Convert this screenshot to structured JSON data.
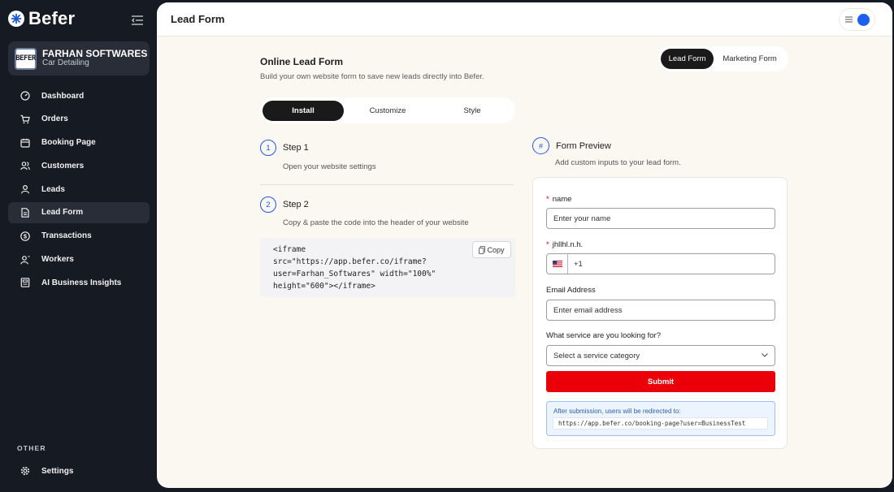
{
  "brand": {
    "name": "Befer"
  },
  "company": {
    "avatar_text": "BEFER",
    "name": "FARHAN SOFTWARES",
    "subtitle": "Car Detailing"
  },
  "sidebar": {
    "items": [
      {
        "label": "Dashboard",
        "icon": "gauge-icon"
      },
      {
        "label": "Orders",
        "icon": "cart-icon"
      },
      {
        "label": "Booking Page",
        "icon": "calendar-icon"
      },
      {
        "label": "Customers",
        "icon": "users-icon"
      },
      {
        "label": "Leads",
        "icon": "user-icon"
      },
      {
        "label": "Lead Form",
        "icon": "document-icon",
        "active": true
      },
      {
        "label": "Transactions",
        "icon": "dollar-icon"
      },
      {
        "label": "Workers",
        "icon": "workers-icon"
      },
      {
        "label": "AI Business Insights",
        "icon": "report-icon"
      }
    ],
    "section_other": "OTHER",
    "settings_label": "Settings"
  },
  "header": {
    "title": "Lead Form"
  },
  "page": {
    "title": "Online Lead Form",
    "subtitle": "Build your own website form to save new leads directly into Befer.",
    "toggle": {
      "active": "Lead Form",
      "inactive": "Marketing Form"
    },
    "tabs": [
      "Install",
      "Customize",
      "Style"
    ],
    "step1": {
      "num": "1",
      "label": "Step 1",
      "desc": "Open your website settings"
    },
    "step2": {
      "num": "2",
      "label": "Step 2",
      "desc": "Copy & paste the code into the header of your website"
    },
    "code": "<iframe\nsrc=\"https://app.befer.co/iframe?\nuser=Farhan_Softwares\" width=\"100%\"\nheight=\"600\"></iframe>",
    "copy_label": "Copy"
  },
  "preview": {
    "icon_text": "#",
    "title": "Form Preview",
    "subtitle": "Add custom inputs to your lead form.",
    "fields": {
      "name_label": "name",
      "name_placeholder": "Enter your name",
      "custom_label": "jhllhl.n.h.",
      "phone_value": "+1",
      "email_label": "Email Address",
      "email_placeholder": "Enter email address",
      "service_label": "What service are you looking for?",
      "service_selected": "Select a service category"
    },
    "submit_label": "Submit",
    "redirect_label": "After submission, users will be redirected to:",
    "redirect_url": "https://app.befer.co/booking-page?user=BusinessTest"
  },
  "colors": {
    "accent_blue": "#2457e0",
    "submit_red": "#eb0009",
    "sidebar_bg": "#161a22",
    "page_bg": "#fbf8f1"
  }
}
